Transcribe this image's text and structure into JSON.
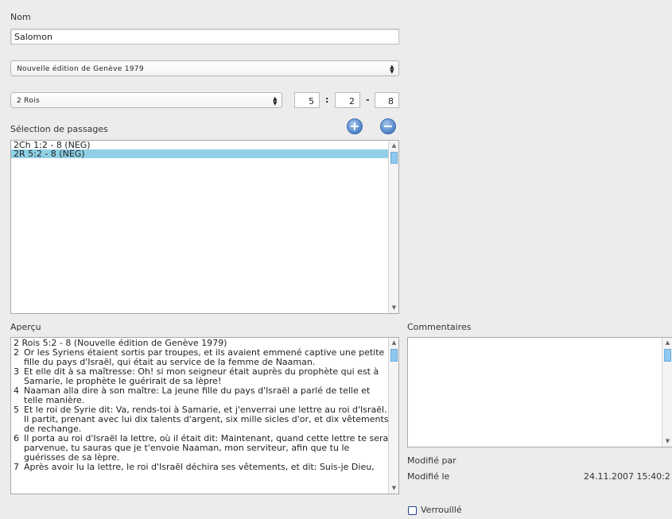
{
  "nom": {
    "label": "Nom",
    "value": "Salomon"
  },
  "edition_select": {
    "value": "Nouvelle édition de Genève 1979"
  },
  "book_select": {
    "value": "2 Rois"
  },
  "reference": {
    "chapter": "5",
    "verse_start": "2",
    "verse_end": "8",
    "sep1": ":",
    "sep2": "-"
  },
  "selection": {
    "label": "Sélection de passages",
    "add_icon": "plus-circle-icon",
    "remove_icon": "minus-circle-icon",
    "items": [
      {
        "label": "2Ch 1:2 - 8 (NEG)",
        "selected": false
      },
      {
        "label": "2R 5:2 - 8 (NEG)",
        "selected": true
      }
    ]
  },
  "apercu": {
    "label": "Aperçu",
    "heading": "2 Rois 5:2 - 8 (Nouvelle édition de Genève 1979)",
    "verses": [
      {
        "n": "2",
        "lines": [
          "Or les Syriens étaient sortis par troupes, et ils avaient emmené captive une petite",
          "fille du pays d'Israël, qui était au service de la femme de Naaman."
        ]
      },
      {
        "n": "3",
        "lines": [
          "Et elle dit à sa maîtresse: Oh! si mon seigneur était auprès du prophète qui est à",
          "Samarie, le prophète le guérirait de sa lèpre!"
        ]
      },
      {
        "n": "4",
        "lines": [
          "Naaman alla dire à son maître: La jeune fille du pays d'Israël a parlé de telle et",
          "telle manière."
        ]
      },
      {
        "n": "5",
        "lines": [
          "Et le roi de Syrie dit: Va, rends-toi à Samarie, et j'enverrai une lettre au roi d'Israël.",
          "Il partit, prenant avec lui dix talents d'argent, six mille sicles d'or, et dix vêtements",
          "de rechange."
        ]
      },
      {
        "n": "6",
        "lines": [
          "Il porta au roi d'Israël la lettre, où il était dit: Maintenant, quand cette lettre te sera",
          "parvenue, tu sauras que je t'envoie Naaman, mon serviteur, afin que tu le",
          "guérisses de sa lèpre."
        ]
      },
      {
        "n": "7",
        "lines": [
          "Après avoir lu la lettre, le roi d'Israël déchira ses vêtements, et dit: Suis-je Dieu,"
        ]
      }
    ]
  },
  "commentaires": {
    "label": "Commentaires",
    "value": ""
  },
  "meta": {
    "modified_by_label": "Modifié par",
    "modified_by_value": "",
    "modified_at_label": "Modifié le",
    "modified_at_value": "24.11.2007 15:40:2"
  },
  "verrouille": {
    "label": "Verrouillé",
    "checked": false
  },
  "icons": {
    "spinner": "updown-arrows-icon",
    "scroll_up": "arrow-up-icon",
    "scroll_down": "arrow-down-icon"
  },
  "colors": {
    "background": "#ececec",
    "selection_highlight": "#8fd0e6",
    "button_blue": "#4d82c6"
  }
}
